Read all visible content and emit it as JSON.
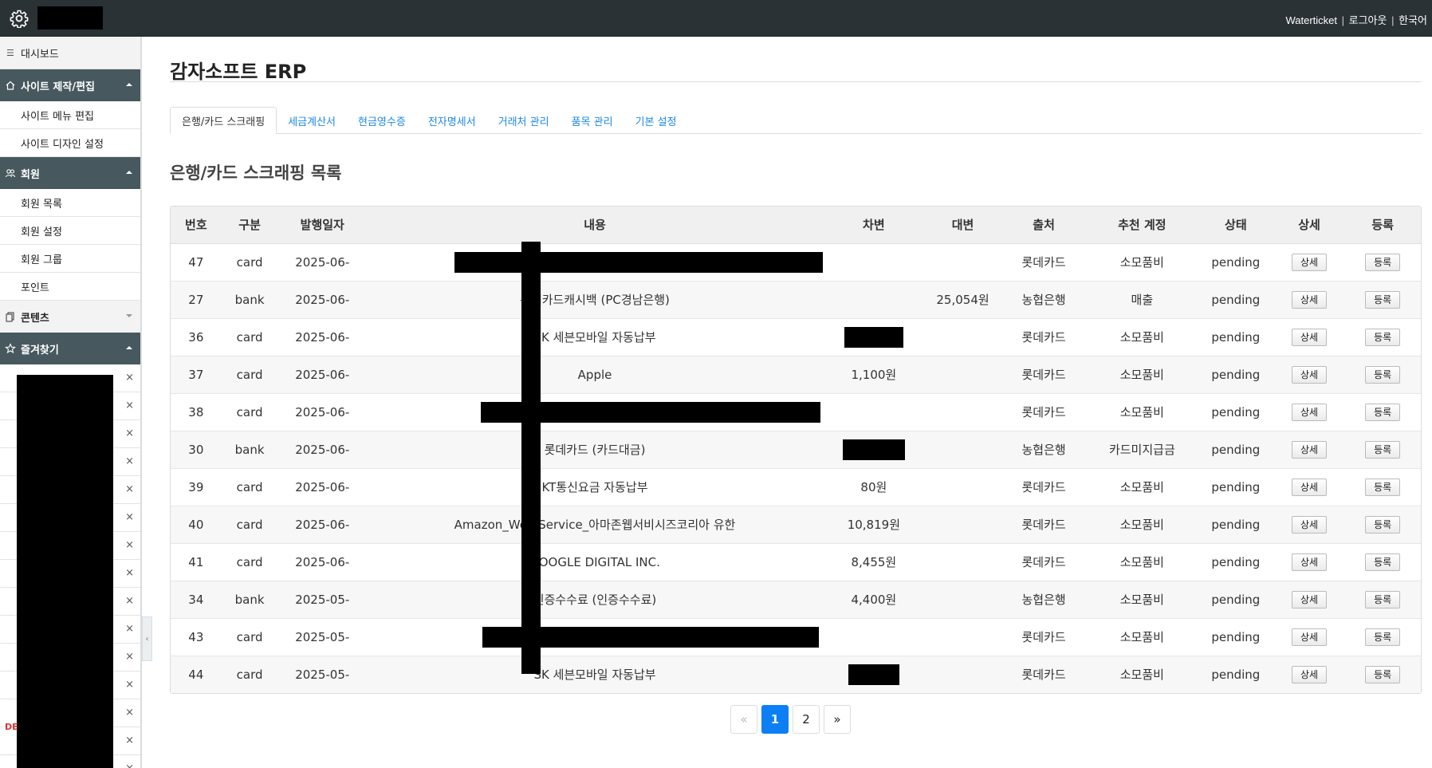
{
  "topbar": {
    "user": "Waterticket",
    "logout": "로그아웃",
    "language": "한국어",
    "separator": "|"
  },
  "sidebar": {
    "dashboard": "대시보드",
    "site_section": "사이트 제작/편집",
    "site_items": [
      "사이트 메뉴 편집",
      "사이트 디자인 설정"
    ],
    "member_section": "회원",
    "member_items": [
      "회원 목록",
      "회원 설정",
      "회원 그룹",
      "포인트"
    ],
    "content_section": "콘텐츠",
    "favorites_section": "즐겨찾기",
    "favorite_remove": "×",
    "de_label": "DE"
  },
  "page": {
    "title": "감자소프트 ERP",
    "tabs": [
      "은행/카드 스크래핑",
      "세금계산서",
      "현금영수증",
      "전자명세서",
      "거래처 관리",
      "품목 관리",
      "기본 설정"
    ],
    "section_title": "은행/카드 스크래핑 목록"
  },
  "table": {
    "headers": [
      "번호",
      "구분",
      "발행일자",
      "내용",
      "차변",
      "대변",
      "출처",
      "추천 계정",
      "상태",
      "상세",
      "등록"
    ],
    "detail_label": "상세",
    "register_label": "등록",
    "rows": [
      {
        "no": "47",
        "type": "card",
        "date": "2025-06-",
        "content": "",
        "debit": "",
        "credit": "",
        "source": "롯데카드",
        "account": "소모품비",
        "status": "pending"
      },
      {
        "no": "27",
        "type": "bank",
        "date": "2025-06-",
        "content": "롯데카드캐시백 (PC경남은행)",
        "debit": "",
        "credit": "25,054원",
        "source": "농협은행",
        "account": "매출",
        "status": "pending"
      },
      {
        "no": "36",
        "type": "card",
        "date": "2025-06-",
        "content": "SK 세븐모바일 자동납부",
        "debit": "",
        "credit": "",
        "source": "롯데카드",
        "account": "소모품비",
        "status": "pending"
      },
      {
        "no": "37",
        "type": "card",
        "date": "2025-06-",
        "content": "Apple",
        "debit": "1,100원",
        "credit": "",
        "source": "롯데카드",
        "account": "소모품비",
        "status": "pending"
      },
      {
        "no": "38",
        "type": "card",
        "date": "2025-06-",
        "content": "",
        "debit": "",
        "credit": "",
        "source": "롯데카드",
        "account": "소모품비",
        "status": "pending"
      },
      {
        "no": "30",
        "type": "bank",
        "date": "2025-06-",
        "content": "롯데카드 (카드대금)",
        "debit": "",
        "credit": "",
        "source": "농협은행",
        "account": "카드미지급금",
        "status": "pending"
      },
      {
        "no": "39",
        "type": "card",
        "date": "2025-06-",
        "content": "KT통신요금 자동납부",
        "debit": "80원",
        "credit": "",
        "source": "롯데카드",
        "account": "소모품비",
        "status": "pending"
      },
      {
        "no": "40",
        "type": "card",
        "date": "2025-06-",
        "content": "Amazon_Web Service_아마존웹서비시즈코리아 유한",
        "debit": "10,819원",
        "credit": "",
        "source": "롯데카드",
        "account": "소모품비",
        "status": "pending"
      },
      {
        "no": "41",
        "type": "card",
        "date": "2025-06-",
        "content": "GOOGLE DIGITAL INC.",
        "debit": "8,455원",
        "credit": "",
        "source": "롯데카드",
        "account": "소모품비",
        "status": "pending"
      },
      {
        "no": "34",
        "type": "bank",
        "date": "2025-05-",
        "content": "인증수수료 (인증수수료)",
        "debit": "4,400원",
        "credit": "",
        "source": "농협은행",
        "account": "소모품비",
        "status": "pending"
      },
      {
        "no": "43",
        "type": "card",
        "date": "2025-05-",
        "content": "",
        "debit": "",
        "credit": "",
        "source": "롯데카드",
        "account": "소모품비",
        "status": "pending"
      },
      {
        "no": "44",
        "type": "card",
        "date": "2025-05-",
        "content": "SK 세븐모바일 자동납부",
        "debit": "",
        "credit": "",
        "source": "롯데카드",
        "account": "소모품비",
        "status": "pending"
      }
    ]
  },
  "pagination": {
    "prev": "«",
    "pages": [
      "1",
      "2"
    ],
    "current": "1",
    "next": "»"
  }
}
